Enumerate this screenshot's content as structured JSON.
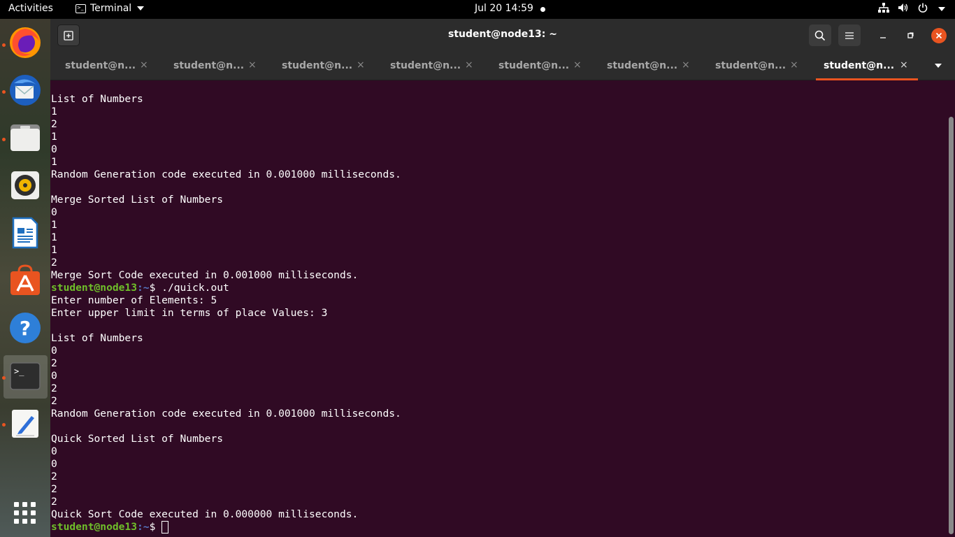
{
  "topbar": {
    "activities": "Activities",
    "app_name": "Terminal",
    "clock": "Jul 20  14:59"
  },
  "dock": {
    "apps": [
      {
        "name": "firefox-icon",
        "running": true
      },
      {
        "name": "thunderbird-icon",
        "running": true
      },
      {
        "name": "files-icon",
        "running": true
      },
      {
        "name": "rhythmbox-icon",
        "running": false
      },
      {
        "name": "libreoffice-writer-icon",
        "running": false
      },
      {
        "name": "ubuntu-software-icon",
        "running": false
      },
      {
        "name": "help-icon",
        "running": false
      },
      {
        "name": "terminal-icon",
        "running": true
      },
      {
        "name": "text-editor-icon",
        "running": true
      },
      {
        "name": "show-applications-icon",
        "running": false
      }
    ]
  },
  "window": {
    "title": "student@node13: ~",
    "tabs": [
      {
        "label": "student@n...",
        "active": false
      },
      {
        "label": "student@n...",
        "active": false
      },
      {
        "label": "student@n...",
        "active": false
      },
      {
        "label": "student@n...",
        "active": false
      },
      {
        "label": "student@n...",
        "active": false
      },
      {
        "label": "student@n...",
        "active": false
      },
      {
        "label": "student@n...",
        "active": false
      },
      {
        "label": "student@n...",
        "active": true
      }
    ],
    "tab_close_glyph": "×"
  },
  "terminal": {
    "prompt_user": "student@node13",
    "prompt_path": ":~",
    "prompt_symbol": "$ ",
    "lines": [
      {
        "type": "text",
        "text": ""
      },
      {
        "type": "text",
        "text": "List of Numbers"
      },
      {
        "type": "text",
        "text": "1"
      },
      {
        "type": "text",
        "text": "2"
      },
      {
        "type": "text",
        "text": "1"
      },
      {
        "type": "text",
        "text": "0"
      },
      {
        "type": "text",
        "text": "1"
      },
      {
        "type": "text",
        "text": "Random Generation code executed in 0.001000 milliseconds."
      },
      {
        "type": "text",
        "text": ""
      },
      {
        "type": "text",
        "text": "Merge Sorted List of Numbers"
      },
      {
        "type": "text",
        "text": "0"
      },
      {
        "type": "text",
        "text": "1"
      },
      {
        "type": "text",
        "text": "1"
      },
      {
        "type": "text",
        "text": "1"
      },
      {
        "type": "text",
        "text": "2"
      },
      {
        "type": "text",
        "text": "Merge Sort Code executed in 0.001000 milliseconds."
      },
      {
        "type": "prompt",
        "text": "./quick.out"
      },
      {
        "type": "text",
        "text": "Enter number of Elements: 5"
      },
      {
        "type": "text",
        "text": "Enter upper limit in terms of place Values: 3"
      },
      {
        "type": "text",
        "text": ""
      },
      {
        "type": "text",
        "text": "List of Numbers"
      },
      {
        "type": "text",
        "text": "0"
      },
      {
        "type": "text",
        "text": "2"
      },
      {
        "type": "text",
        "text": "0"
      },
      {
        "type": "text",
        "text": "2"
      },
      {
        "type": "text",
        "text": "2"
      },
      {
        "type": "text",
        "text": "Random Generation code executed in 0.001000 milliseconds."
      },
      {
        "type": "text",
        "text": ""
      },
      {
        "type": "text",
        "text": "Quick Sorted List of Numbers"
      },
      {
        "type": "text",
        "text": "0"
      },
      {
        "type": "text",
        "text": "0"
      },
      {
        "type": "text",
        "text": "2"
      },
      {
        "type": "text",
        "text": "2"
      },
      {
        "type": "text",
        "text": "2"
      },
      {
        "type": "text",
        "text": "Quick Sort Code executed in 0.000000 milliseconds."
      },
      {
        "type": "prompt_cursor",
        "text": ""
      }
    ]
  },
  "colors": {
    "terminal_bg": "#300a24",
    "accent": "#e95420",
    "prompt_user": "#6fbf2a",
    "prompt_path": "#5677c4"
  }
}
